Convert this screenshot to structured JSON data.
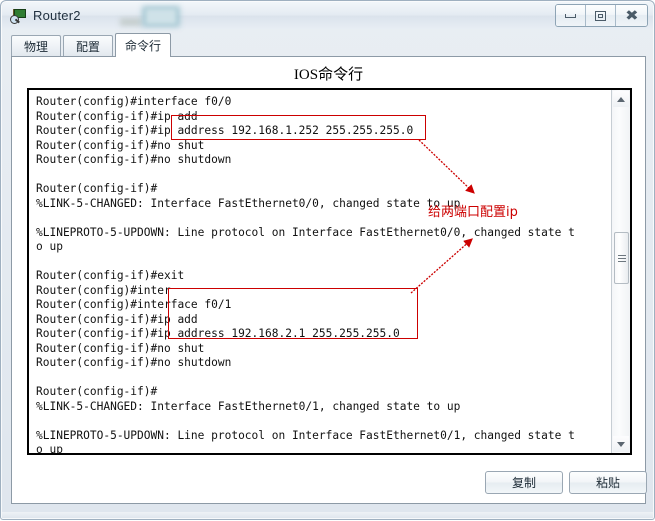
{
  "window": {
    "title": "Router2",
    "icon": "packet-tracer-router-icon",
    "redaction_present": true,
    "controls": {
      "minimize": "minimize-icon",
      "maximize": "maximize-icon",
      "close": "close-icon"
    }
  },
  "tabs": [
    {
      "label": "物理",
      "active": false
    },
    {
      "label": "配置",
      "active": false
    },
    {
      "label": "命令行",
      "active": true
    }
  ],
  "panel": {
    "title": "IOS命令行"
  },
  "terminal": {
    "lines": [
      "Router(config)#interface f0/0",
      "Router(config-if)#ip add",
      "Router(config-if)#ip address 192.168.1.252 255.255.255.0",
      "Router(config-if)#no shut",
      "Router(config-if)#no shutdown",
      "",
      "Router(config-if)#",
      "%LINK-5-CHANGED: Interface FastEthernet0/0, changed state to up",
      "",
      "%LINEPROTO-5-UPDOWN: Line protocol on Interface FastEthernet0/0, changed state t",
      "o up",
      "",
      "Router(config-if)#exit",
      "Router(config)#inter",
      "Router(config)#interface f0/1",
      "Router(config-if)#ip add",
      "Router(config-if)#ip address 192.168.2.1 255.255.255.0",
      "Router(config-if)#no shut",
      "Router(config-if)#no shutdown",
      "",
      "Router(config-if)#",
      "%LINK-5-CHANGED: Interface FastEthernet0/1, changed state to up",
      "",
      "%LINEPROTO-5-UPDOWN: Line protocol on Interface FastEthernet0/1, changed state t",
      "o up"
    ]
  },
  "annotations": {
    "color": "#cc0000",
    "note": "给两端口配置ip",
    "boxes": [
      {
        "label": "ip address 192.168.1.252 255.255.255.0"
      },
      {
        "label": "interface f0/1 / ip address 192.168.2.1 255.255.255.0"
      }
    ]
  },
  "scrollbar": {
    "up_arrow": "scroll-up-icon",
    "down_arrow": "scroll-down-icon",
    "thumb": "scroll-thumb"
  },
  "buttons": {
    "copy": "复制",
    "paste": "粘贴"
  }
}
